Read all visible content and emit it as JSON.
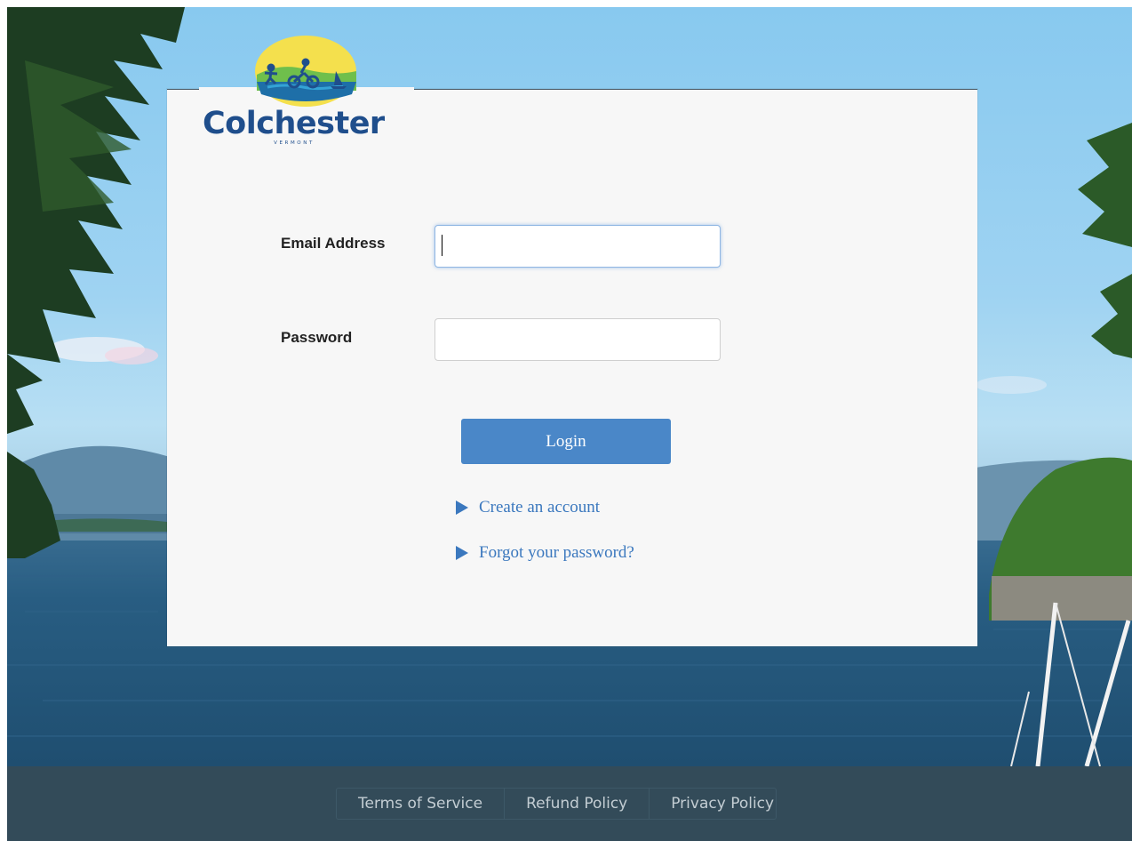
{
  "brand": {
    "name": "Colchester",
    "state": "VERMONT",
    "logo_icon": "runner-cyclist-sailboat-logo"
  },
  "form": {
    "email": {
      "label": "Email Address",
      "value": "",
      "placeholder": ""
    },
    "password": {
      "label": "Password",
      "value": "",
      "placeholder": ""
    },
    "login_label": "Login",
    "links": [
      {
        "label": "Create an account",
        "icon": "triangle-right-icon"
      },
      {
        "label": "Forgot your password?",
        "icon": "triangle-right-icon"
      }
    ]
  },
  "footer": {
    "links": [
      "Terms of Service",
      "Refund Policy",
      "Privacy Policy"
    ]
  },
  "colors": {
    "accent": "#4a87c8",
    "link": "#3b78be",
    "footer_bg": "#334b59",
    "brand_blue": "#1f4e8c"
  }
}
